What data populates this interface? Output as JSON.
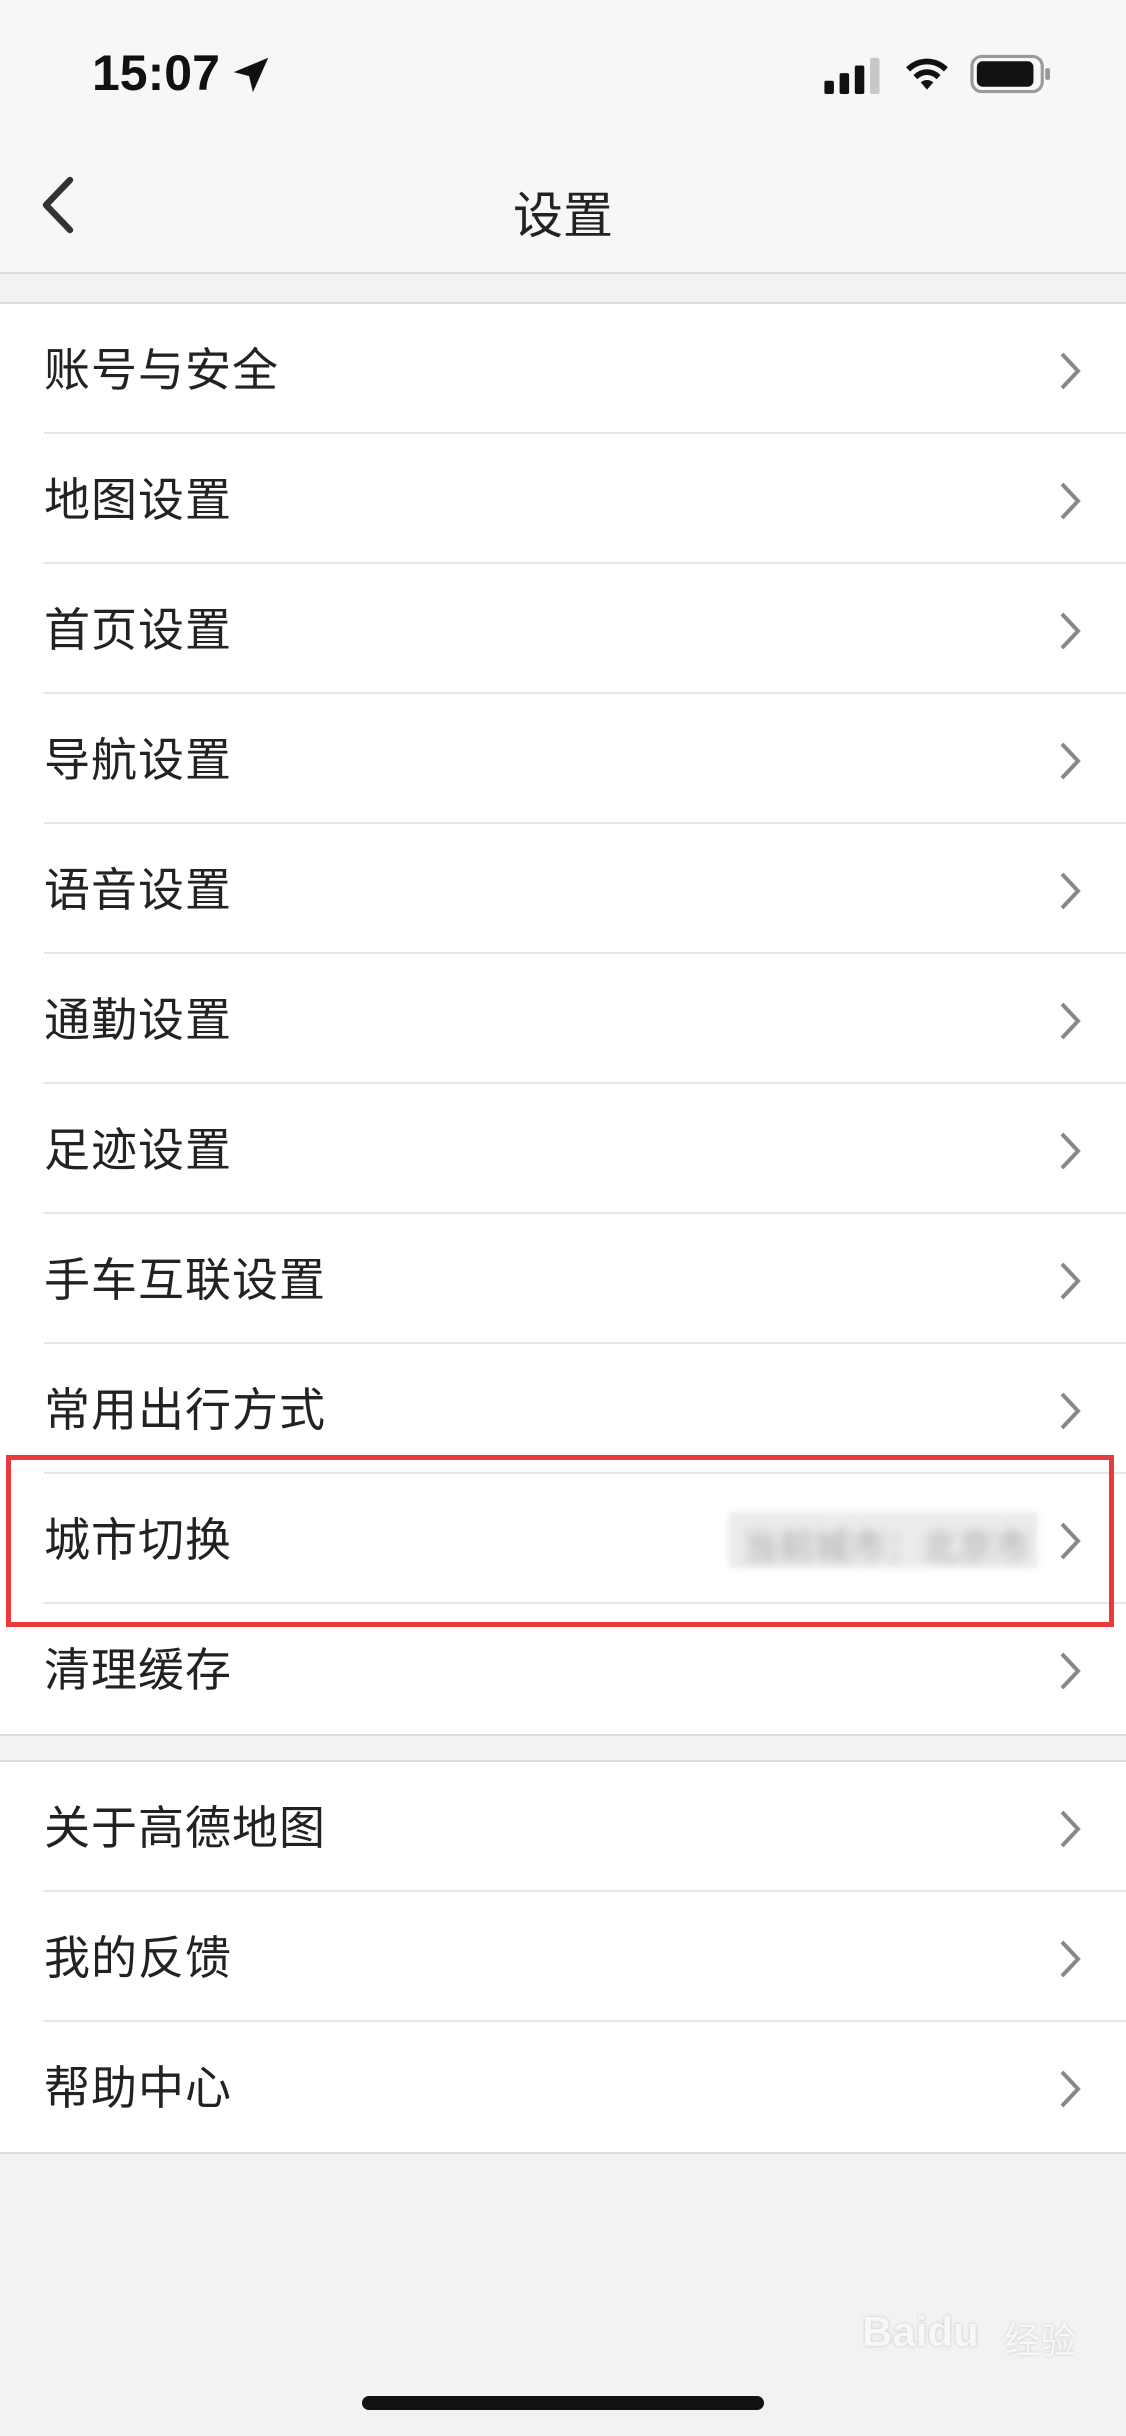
{
  "status_bar": {
    "time": "15:07",
    "icons": [
      "location-arrow-icon",
      "cellular-signal-icon",
      "wifi-icon",
      "battery-icon"
    ]
  },
  "header": {
    "title": "设置",
    "back_icon": "chevron-left-icon"
  },
  "group1": {
    "items": [
      {
        "label": "账号与安全"
      },
      {
        "label": "地图设置"
      },
      {
        "label": "首页设置"
      },
      {
        "label": "导航设置"
      },
      {
        "label": "语音设置"
      },
      {
        "label": "通勤设置"
      },
      {
        "label": "足迹设置"
      },
      {
        "label": "手车互联设置"
      },
      {
        "label": "常用出行方式"
      },
      {
        "label": "城市切换",
        "value": "当前城市：北京市"
      },
      {
        "label": "清理缓存"
      }
    ]
  },
  "group2": {
    "items": [
      {
        "label": "关于高德地图"
      },
      {
        "label": "我的反馈"
      },
      {
        "label": "帮助中心"
      }
    ]
  },
  "watermark": {
    "brand": "Baidu",
    "suffix": "经验"
  },
  "colors": {
    "highlight": "#e8393c",
    "background": "#f2f2f2",
    "row_background": "#ffffff"
  }
}
